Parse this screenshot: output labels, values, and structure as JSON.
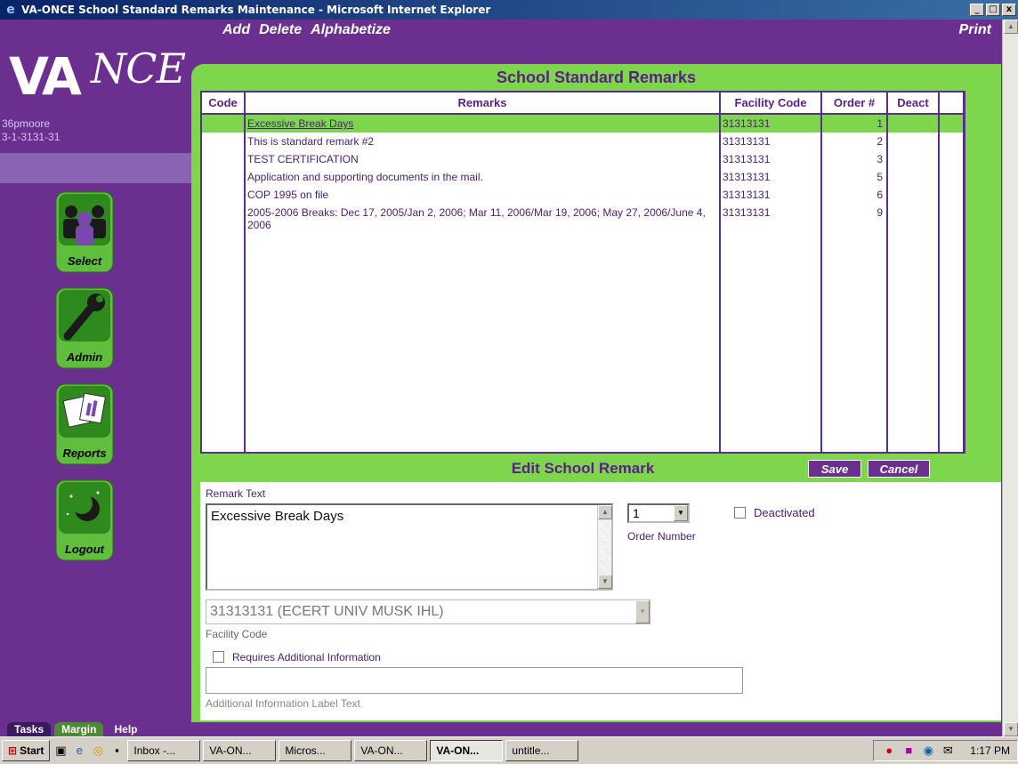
{
  "window": {
    "title": "VA-ONCE School Standard Remarks Maintenance - Microsoft Internet Explorer",
    "min": "_",
    "max": "□",
    "close": "x"
  },
  "logo": {
    "va": "VA",
    "once": "NCE"
  },
  "user": {
    "name": "36pmoore",
    "id": "3-1-3131-31"
  },
  "topnav": {
    "add": "Add",
    "delete": "Delete",
    "alphabetize": "Alphabetize",
    "print": "Print"
  },
  "sidebar": {
    "select": "Select",
    "admin": "Admin",
    "reports": "Reports",
    "logout": "Logout"
  },
  "panel": {
    "title": "School Standard Remarks"
  },
  "table": {
    "headers": {
      "code": "Code",
      "remarks": "Remarks",
      "facility": "Facility Code",
      "order": "Order #",
      "deact": "Deact"
    },
    "rows": [
      {
        "code": "",
        "remark": "Excessive Break Days",
        "facility": "31313131",
        "order": "1",
        "deact": ""
      },
      {
        "code": "",
        "remark": "This is standard remark #2",
        "facility": "31313131",
        "order": "2",
        "deact": ""
      },
      {
        "code": "",
        "remark": "TEST CERTIFICATION",
        "facility": "31313131",
        "order": "3",
        "deact": ""
      },
      {
        "code": "",
        "remark": "Application and supporting documents in the mail.",
        "facility": "31313131",
        "order": "5",
        "deact": ""
      },
      {
        "code": "",
        "remark": "COP 1995 on file",
        "facility": "31313131",
        "order": "6",
        "deact": ""
      },
      {
        "code": "",
        "remark": "2005-2006 Breaks: Dec 17, 2005/Jan 2, 2006; Mar 11, 2006/Mar 19, 2006; May 27, 2006/June 4, 2006",
        "facility": "31313131",
        "order": "9",
        "deact": ""
      }
    ]
  },
  "edit": {
    "title": "Edit School Remark",
    "save": "Save",
    "cancel": "Cancel",
    "remark_text_label": "Remark Text",
    "remark_text_value": "Excessive Break Days",
    "order_value": "1",
    "order_label": "Order Number",
    "deactivated_label": "Deactivated",
    "facility_value": "31313131 (ECERT UNIV MUSK IHL)",
    "facility_label": "Facility Code",
    "requires_addl_label": "Requires Additional Information",
    "addl_label_text": "Additional Information Label Text"
  },
  "bottom_tabs": {
    "tasks": "Tasks",
    "margin": "Margin",
    "help": "Help"
  },
  "taskbar": {
    "start": "Start",
    "items": [
      "Inbox -...",
      "VA-ON...",
      "Micros...",
      "VA-ON...",
      "VA-ON...",
      "untitle..."
    ],
    "clock": "1:17 PM"
  }
}
